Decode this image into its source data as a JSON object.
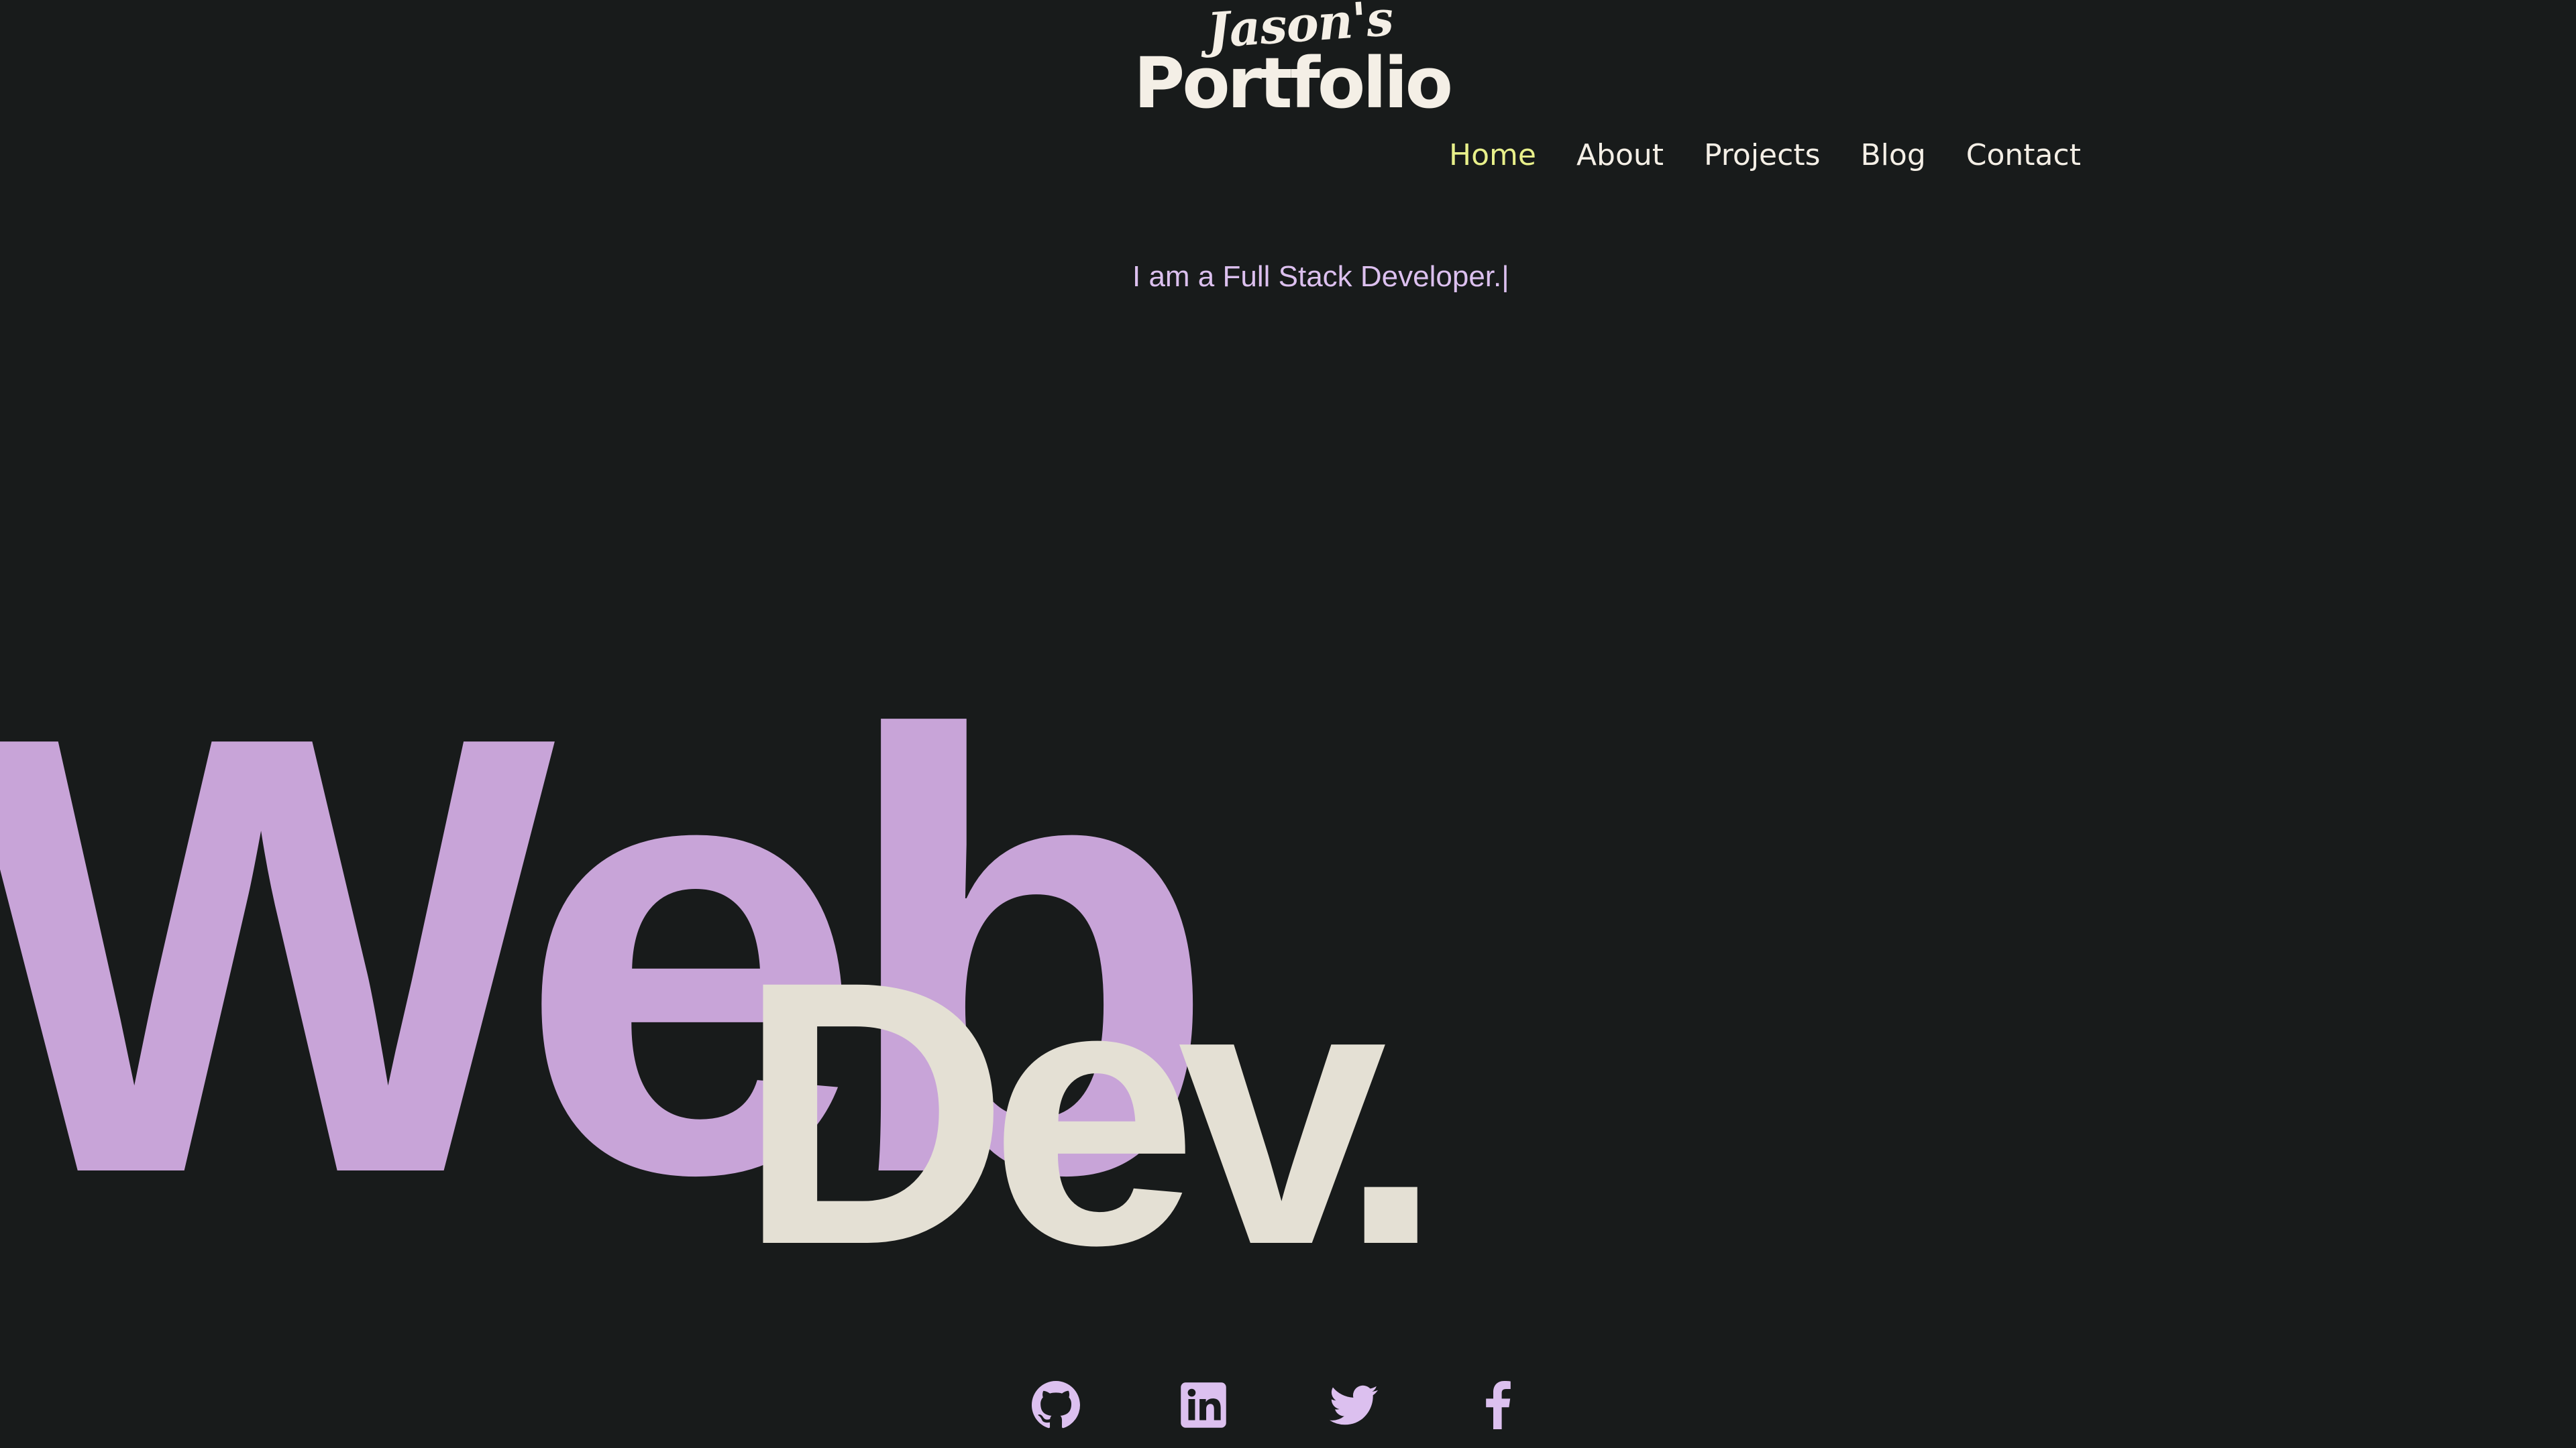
{
  "logo": {
    "script": "Jason's",
    "main": "Portfolio"
  },
  "nav": {
    "items": [
      {
        "label": "Home",
        "active": true
      },
      {
        "label": "About",
        "active": false
      },
      {
        "label": "Projects",
        "active": false
      },
      {
        "label": "Blog",
        "active": false
      },
      {
        "label": "Contact",
        "active": false
      }
    ]
  },
  "hero": {
    "tagline": "I am a Full Stack Developer.",
    "caret": "|",
    "word1": "Web",
    "word2": "Dev."
  },
  "social": [
    {
      "icon": "github-icon"
    },
    {
      "icon": "linkedin-icon"
    },
    {
      "icon": "twitter-icon"
    },
    {
      "icon": "facebook-icon"
    }
  ],
  "colors": {
    "background": "#181b1b",
    "accent_purple": "#c8a4d8",
    "accent_light": "#dcc0ef",
    "nav_active": "#e8f08a",
    "text_light": "#f4efe6",
    "hero_dev": "#e4e0d4"
  }
}
